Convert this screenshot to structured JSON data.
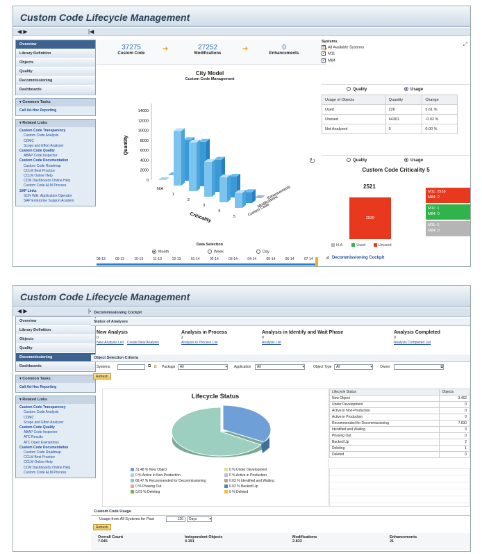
{
  "app_title": "Custom Code Lifecycle Management",
  "nav_arrows": "◀ ▶",
  "nav_collapse": "|◀",
  "menu1": [
    "Overview",
    "Library Definition",
    "Objects",
    "Quality",
    "Decommissioning",
    "Dashboards"
  ],
  "menu2": [
    "Overview",
    "Library Definition",
    "Objects",
    "Quality",
    "Decommissioning",
    "Dashboards"
  ],
  "common_tasks": "Common Tasks",
  "call_adhoc": "Call Ad-Hoc Reporting",
  "related_links": "Related Links",
  "links1": [
    {
      "t": "Custom Code Transparency",
      "b": true
    },
    {
      "t": "Custom Code Analysis"
    },
    {
      "t": "CDMC"
    },
    {
      "t": "Scope and Effort Analyzer"
    },
    {
      "t": "Custom Code Quality",
      "b": true
    },
    {
      "t": "ABAP Code Inspector"
    },
    {
      "t": "Custom Code Documentation",
      "b": true
    },
    {
      "t": "Custom Code Roadmap"
    },
    {
      "t": "CCLM Best Practice"
    },
    {
      "t": "CCLM Online Help"
    },
    {
      "t": "CCM Dashboards Online Help"
    },
    {
      "t": "Custom Code ALM Process"
    },
    {
      "t": "SAP Links",
      "b": true
    },
    {
      "t": "SCN Wiki: Application Operator"
    },
    {
      "t": "SAP Enterprise Support Academ"
    }
  ],
  "links2": [
    {
      "t": "Custom Code Transparency",
      "b": true
    },
    {
      "t": "Custom Code Analysis"
    },
    {
      "t": "CDMC"
    },
    {
      "t": "Scope and Effort Analyzer"
    },
    {
      "t": "Custom Code Quality",
      "b": true
    },
    {
      "t": "ABAP Code Inspector"
    },
    {
      "t": "ATC Results"
    },
    {
      "t": "ATC Open Exemptions"
    },
    {
      "t": "Custom Code Documentation",
      "b": true
    },
    {
      "t": "Custom Code Roadmap"
    },
    {
      "t": "CCLM Best Practice"
    },
    {
      "t": "CCLM Online Help"
    },
    {
      "t": "CCM Dashboards Online Help"
    },
    {
      "t": "Custom Code ALM Process"
    }
  ],
  "kpi": [
    {
      "value": "37275",
      "label": "Custom Code"
    },
    {
      "value": "27252",
      "label": "Modifications"
    },
    {
      "value": "0",
      "label": "Enhancements"
    }
  ],
  "systems": {
    "title": "Systems",
    "items": [
      "All Available Systems",
      "M11",
      "M84"
    ]
  },
  "qu_quality": "Quality",
  "qu_usage": "Usage",
  "usage_table": {
    "headers": [
      "Usage of Objects",
      "Quantity",
      "Change"
    ],
    "rows": [
      [
        "Used",
        "226",
        "5.61 %"
      ],
      [
        "Unused",
        "64301",
        "-0.02 %"
      ],
      [
        "Not Analyzed",
        "0",
        "0.00 %"
      ]
    ]
  },
  "criticality": {
    "title": "Custom Code Criticality 5",
    "total": "2521",
    "big": "2520",
    "boxes": [
      {
        "l1": "M11: 2518",
        "l2": "M84: 2",
        "color": "#e8391e"
      },
      {
        "l1": "M11: 1",
        "l2": "M84: 0",
        "color": "#2fb34a"
      },
      {
        "l1": "M11: 0",
        "l2": "M84: 0",
        "color": "#b5b5b5"
      }
    ],
    "legend": [
      "N.A.",
      "Used",
      "Unused"
    ]
  },
  "decom_cockpit_link": "Decommissioning Cockpit",
  "city_model": {
    "title": "City Model",
    "subtitle": "Custom Code Management",
    "zlabel": "Quantity",
    "xlabel": "Criticality",
    "yticks": [
      "14000",
      "12000",
      "10000",
      "8000",
      "6000",
      "4000",
      "2000",
      "0"
    ],
    "crit": [
      "N/A",
      "1",
      "2",
      "3",
      "4",
      "5"
    ],
    "types": [
      "Custom Code",
      "Modifications",
      "Enhancements"
    ]
  },
  "chart_data": [
    {
      "type": "bar",
      "title": "City Model",
      "subtitle": "Custom Code Management",
      "xlabel": "Criticality",
      "ylabel": "Quantity",
      "ylim": [
        0,
        14000
      ],
      "categories": [
        "N/A",
        "1",
        "2",
        "3",
        "4",
        "5"
      ],
      "series": [
        {
          "name": "Custom Code",
          "values": [
            0,
            11000,
            9800,
            7000,
            5000,
            3000
          ]
        },
        {
          "name": "Modifications",
          "values": [
            0,
            8200,
            9000,
            6500,
            4200,
            2200
          ]
        },
        {
          "name": "Enhancements",
          "values": [
            0,
            0,
            0,
            0,
            0,
            0
          ]
        }
      ]
    },
    {
      "type": "pie",
      "title": "Lifecycle Status",
      "categories": [
        "New Object",
        "Active in Non-Production",
        "Recommended for Decommissioning",
        "Phasing Out",
        "Deleting",
        "Under Development",
        "Active in Production",
        "Identified and Waiting",
        "Backed Up",
        "Deleted"
      ],
      "values": [
        31.48,
        0,
        68.47,
        0,
        0.01,
        0,
        0,
        0.03,
        0.02,
        0
      ]
    }
  ],
  "data_selection": {
    "title": "Data Selection",
    "options": [
      "Month",
      "Week",
      "Day"
    ],
    "months": [
      "08-13",
      "09-13",
      "10-13",
      "11-13",
      "12-13",
      "01-14",
      "02-14",
      "03-14",
      "04-14",
      "05-14",
      "06-14",
      "07-14"
    ]
  },
  "p2": {
    "cockpit_title": "Decommissioning Cockpit",
    "status_title": "Status of Analyses",
    "analyses": [
      {
        "title": "New Analysis",
        "count": "0",
        "links": [
          "New Analysis List",
          "Create New Analysis"
        ]
      },
      {
        "title": "Analysis in Process",
        "count": "2",
        "links": [
          "Analysis in Process List"
        ]
      },
      {
        "title": "Analysis in Identify and Wait Phase",
        "count": "0",
        "links": [
          "Analysis List"
        ]
      },
      {
        "title": "Analysis Completed",
        "count": "0",
        "links": [
          "Analysis Completed List"
        ]
      }
    ],
    "criteria_title": "Object Selection Criteria",
    "systems_lbl": "Systems:",
    "package_lbl": "Package",
    "package_val": "All",
    "app_lbl": "Application",
    "app_val": "All",
    "objtype_lbl": "Object Type",
    "objtype_val": "All",
    "owner_lbl": "Owner",
    "refresh": "Refresh",
    "pie_title": "Lifecycle Status",
    "pie_legend": [
      {
        "t": "31.48 % New Object",
        "c": "#6e9fd6"
      },
      {
        "t": "0 % Under Development",
        "c": "#d7e68a"
      },
      {
        "t": "0 % Active in Non-Production",
        "c": "#b9c9d8"
      },
      {
        "t": "0 % Active in Production",
        "c": "#c9b6dd"
      },
      {
        "t": "68.47 % Recommended for Decommissioning",
        "c": "#8fc8b8"
      },
      {
        "t": "0.03 % Identified and Waiting",
        "c": "#c1a27a"
      },
      {
        "t": "0 % Phasing Out",
        "c": "#e8a0a0"
      },
      {
        "t": "0.02 % Backed Up",
        "c": "#4b88c0"
      },
      {
        "t": "0.01 % Deleting",
        "c": "#7fb24d"
      },
      {
        "t": "0 % Deleted",
        "c": "#f0c040"
      }
    ],
    "status_table": {
      "headers": [
        "Lifecycle Status",
        "Objects"
      ],
      "rows": [
        [
          "New Object",
          "3.462"
        ],
        [
          "Under Development",
          "0"
        ],
        [
          "Active in Non-Production",
          "0"
        ],
        [
          "Active in Production",
          "0"
        ],
        [
          "Recommended for Decommissioning",
          "7.530"
        ],
        [
          "Identified and Waiting",
          "3"
        ],
        [
          "Phasing Out",
          "0"
        ],
        [
          "Backed Up",
          "2"
        ],
        [
          "Deleting",
          "1"
        ],
        [
          "Deleted",
          "0"
        ]
      ]
    },
    "usage_title": "Custom Code Usage",
    "usage_from": "Usage from All Systems for Past",
    "usage_days": "120",
    "usage_unit": "Days",
    "bottom_kpis": [
      {
        "label": "Overall Count",
        "value": "7.045"
      },
      {
        "label": "Independent Objects",
        "value": "4.191"
      },
      {
        "label": "Modifications",
        "value": "2.833"
      },
      {
        "label": "Enhancements",
        "value": "21"
      }
    ]
  }
}
